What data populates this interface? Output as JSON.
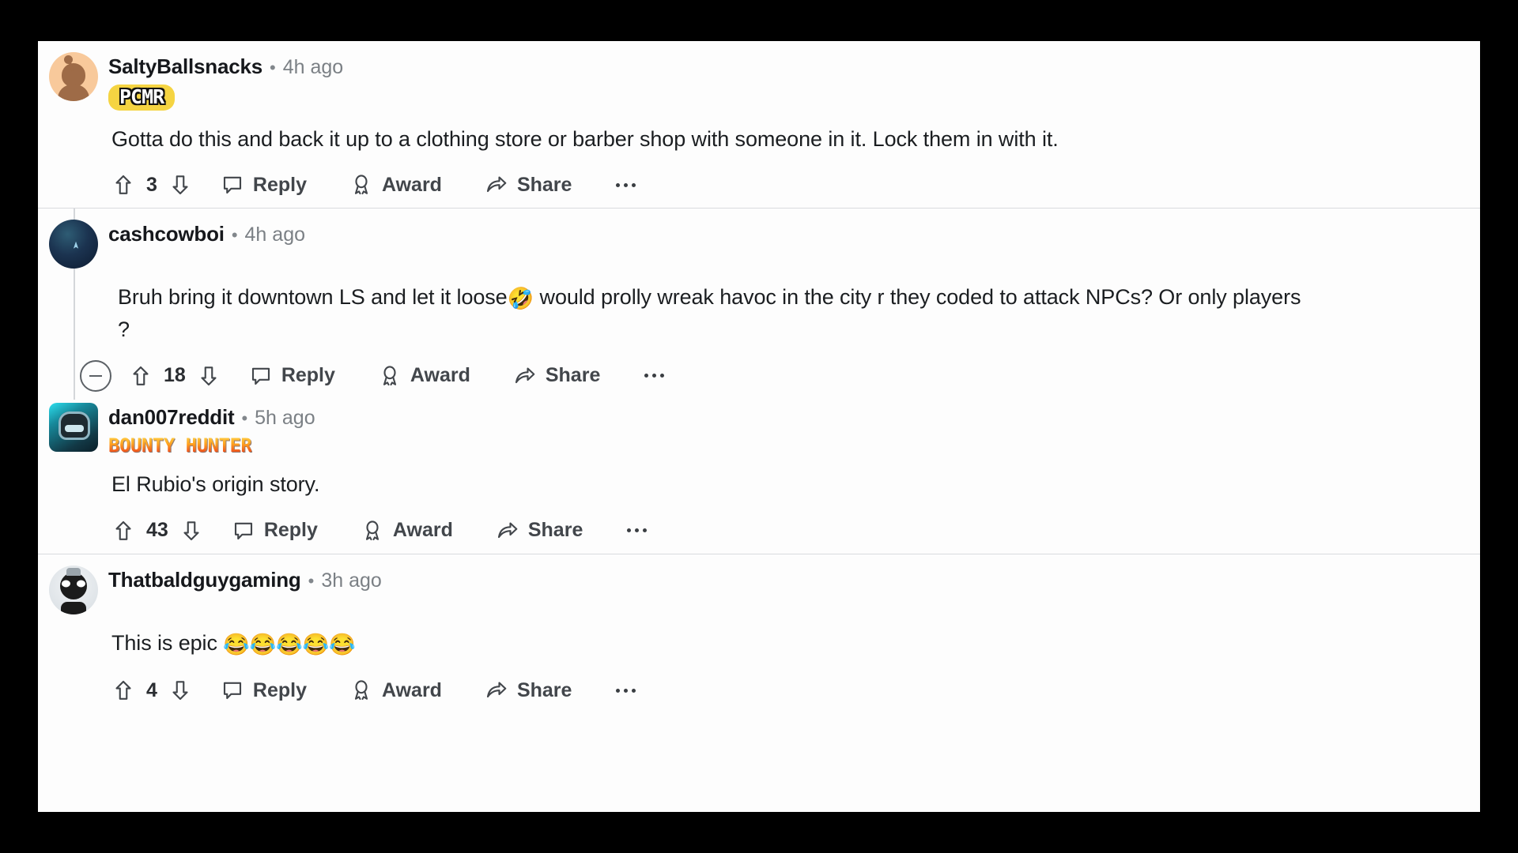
{
  "app": {
    "name": "reddit-comment-thread",
    "background_color": "#000000",
    "card_color": "#fdfdfd"
  },
  "labels": {
    "reply": "Reply",
    "award": "Award",
    "share": "Share",
    "separator": "•",
    "more": "more-options"
  },
  "comments": [
    {
      "id": "c1",
      "username": "SaltyBallsnacks",
      "timestamp": "4h ago",
      "flair": "PCMR",
      "flair_type": "pcmr",
      "avatar": "snoo-avatar",
      "body": "Gotta do this and back it up to a clothing store or barber shop with someone in it. Lock them in with it.",
      "votes": "3",
      "collapsible": false,
      "nested": false
    },
    {
      "id": "c2",
      "username": "cashcowboi",
      "timestamp": "4h ago",
      "flair": "",
      "flair_type": "none",
      "avatar": "nebula-avatar",
      "body_pre": "Bruh bring it downtown LS and let it loose",
      "body_emoji": "🤣",
      "body_post": " would prolly wreak havoc in the city r they coded to attack NPCs? Or only players ?",
      "votes": "18",
      "collapsible": true,
      "nested": false
    },
    {
      "id": "c3",
      "username": "dan007reddit",
      "timestamp": "5h ago",
      "flair": "BOUNTY HUNTER",
      "flair_type": "bounty",
      "avatar": "mech-avatar",
      "body": "El Rubio's origin story.",
      "votes": "43",
      "collapsible": false,
      "nested": true
    },
    {
      "id": "c4",
      "username": "Thatbaldguygaming",
      "timestamp": "3h ago",
      "flair": "",
      "flair_type": "none",
      "avatar": "skull-avatar",
      "body_pre": "This is epic ",
      "body_emoji": "😂😂😂😂😂",
      "body_post": "",
      "votes": "4",
      "collapsible": false,
      "nested": false
    }
  ],
  "colors": {
    "username": "#16181c",
    "timestamp": "#7b8085",
    "body_text": "#1b1e21",
    "action_text": "#42464b",
    "divider": "#d9dbde",
    "pcmr_flair_bg": "#f5d442"
  }
}
